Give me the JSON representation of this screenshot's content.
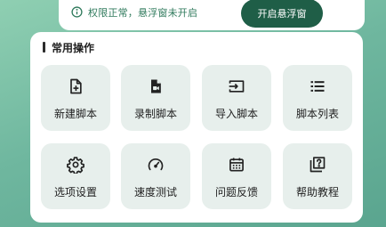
{
  "banner": {
    "status_text": "权限正常，悬浮窗未开启",
    "open_button_label": "开启悬浮窗"
  },
  "panel": {
    "title": "常用操作",
    "tiles": [
      {
        "label": "新建脚本",
        "icon": "new-file-icon"
      },
      {
        "label": "录制脚本",
        "icon": "record-icon"
      },
      {
        "label": "导入脚本",
        "icon": "import-icon"
      },
      {
        "label": "脚本列表",
        "icon": "list-icon"
      },
      {
        "label": "选项设置",
        "icon": "gear-icon"
      },
      {
        "label": "速度测试",
        "icon": "speedometer-icon"
      },
      {
        "label": "问题反馈",
        "icon": "calendar-icon"
      },
      {
        "label": "帮助教程",
        "icon": "help-book-icon"
      }
    ]
  },
  "colors": {
    "accent": "#1f5e47",
    "banner_text": "#2f7a5c",
    "tile_bg": "#e7efec"
  }
}
